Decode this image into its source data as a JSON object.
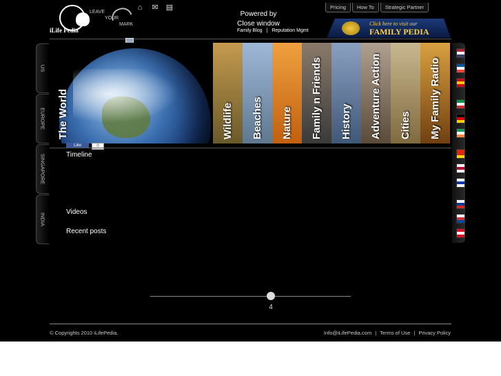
{
  "header": {
    "logo_brand": "iLife Pedia",
    "tagline": [
      "LEAVE",
      "YOUR",
      "MARK"
    ],
    "powered_line1": "Powered by",
    "powered_line2": "Close window",
    "subnav": [
      "Family Blog",
      "Reputation Mgmt"
    ],
    "topnav": [
      "Pricing",
      "How To",
      "Strategic Partner"
    ],
    "banner_line1": "Click here to visit our",
    "banner_line2": "FAMILY PEDIA",
    "icons": [
      "home-icon",
      "mail-icon",
      "note-icon"
    ]
  },
  "side_tabs": [
    "US",
    "EUROPE",
    "SINGAPORE",
    "INDIA"
  ],
  "hero": {
    "main_label": "The World",
    "strips": [
      {
        "label": "Wildlife",
        "color_top": "#c49a4e",
        "color_bottom": "#6a5a2a"
      },
      {
        "label": "Beaches",
        "color_top": "#9fb8d8",
        "color_bottom": "#5f7890"
      },
      {
        "label": "Nature",
        "color_top": "#f0a040",
        "color_bottom": "#c06010"
      },
      {
        "label": "Family n Friends",
        "color_top": "#8a7a6a",
        "color_bottom": "#3a3a3a"
      },
      {
        "label": "History",
        "color_top": "#8aa0c0",
        "color_bottom": "#405878"
      },
      {
        "label": "Adventure Action",
        "color_top": "#b0a090",
        "color_bottom": "#5a4a3a"
      },
      {
        "label": "Cities",
        "color_top": "#c8b890",
        "color_bottom": "#806a40"
      },
      {
        "label": "My Family Radio",
        "color_top": "#d8a040",
        "color_bottom": "#704010"
      }
    ]
  },
  "flags": [
    {
      "name": "us-flag-icon",
      "colors": [
        "#b22234",
        "#ffffff",
        "#3c3b6e"
      ]
    },
    {
      "name": "france-flag-icon",
      "colors": [
        "#0055a4",
        "#ffffff",
        "#ef4135"
      ]
    },
    {
      "name": "spain-flag-icon",
      "colors": [
        "#c60b1e",
        "#ffc400",
        "#c60b1e"
      ]
    },
    {
      "name": "italy-flag-icon",
      "colors": [
        "#009246",
        "#ffffff",
        "#ce2b37"
      ]
    },
    {
      "name": "germany-flag-icon",
      "colors": [
        "#000000",
        "#dd0000",
        "#ffce00"
      ]
    },
    {
      "name": "ireland-flag-icon",
      "colors": [
        "#169b62",
        "#ffffff",
        "#ff883e"
      ]
    },
    {
      "name": "china-flag-icon",
      "colors": [
        "#de2910",
        "#de2910",
        "#ffde00"
      ]
    },
    {
      "name": "japan-flag-icon",
      "colors": [
        "#ffffff",
        "#bc002d",
        "#ffffff"
      ]
    },
    {
      "name": "israel-flag-icon",
      "colors": [
        "#ffffff",
        "#0038b8",
        "#ffffff"
      ]
    },
    {
      "name": "russia-flag-icon",
      "colors": [
        "#ffffff",
        "#0039a6",
        "#d52b1e"
      ]
    },
    {
      "name": "korea-flag-icon",
      "colors": [
        "#ffffff",
        "#cd2e3a",
        "#0047a0"
      ]
    },
    {
      "name": "peru-flag-icon",
      "colors": [
        "#d91023",
        "#ffffff",
        "#d91023"
      ]
    }
  ],
  "social": {
    "like_label": "Like",
    "like_count": "0"
  },
  "content": {
    "timeline": "Timeline",
    "videos": "Videos",
    "recent_posts": "Recent posts"
  },
  "slider": {
    "value": "4"
  },
  "footer": {
    "copyright": "© Copyrights 2010 iLifePedia.",
    "links": [
      "Info@iLifePedia.com",
      "Terms of Use",
      "Privacy Policy"
    ]
  }
}
